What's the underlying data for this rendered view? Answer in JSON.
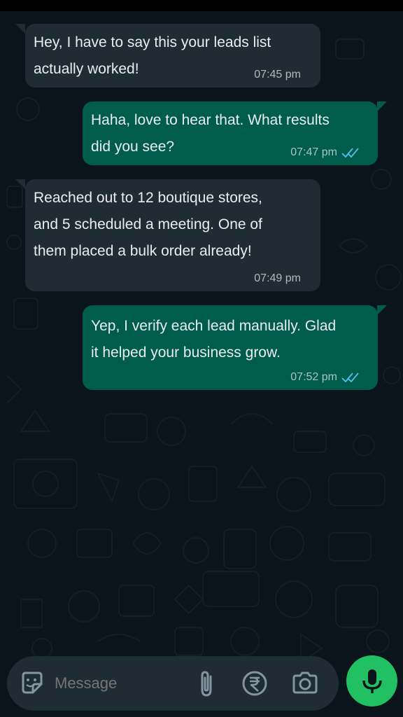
{
  "colors": {
    "background": "#0b141a",
    "incoming_bubble": "#202c33",
    "outgoing_bubble": "#005c4b",
    "read_ticks": "#53bdeb",
    "mic_button": "#21c063"
  },
  "messages": [
    {
      "direction": "incoming",
      "text": "Hey, I have to say this your leads list\nactually worked!",
      "time": "07:45 pm"
    },
    {
      "direction": "outgoing",
      "text": "Haha, love to hear that. What results\ndid you see?",
      "time": "07:47 pm",
      "status": "read"
    },
    {
      "direction": "incoming",
      "text": "Reached out to 12 boutique stores,\nand 5 scheduled a meeting. One of\nthem placed a bulk order already!",
      "time": "07:49 pm"
    },
    {
      "direction": "outgoing",
      "text": "Yep, I verify each lead manually. Glad\nit helped your business grow.",
      "time": "07:52 pm",
      "status": "read"
    }
  ],
  "composer": {
    "placeholder": "Message",
    "icons": [
      "sticker-icon",
      "paperclip-icon",
      "rupee-icon",
      "camera-icon",
      "mic-icon"
    ]
  }
}
